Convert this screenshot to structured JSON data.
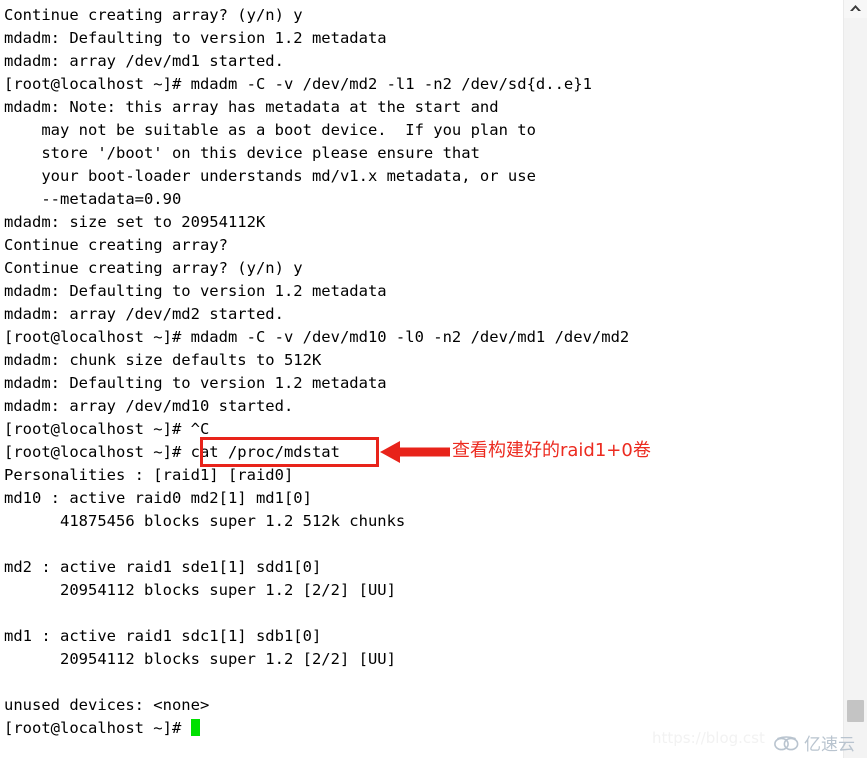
{
  "terminal": {
    "lines": [
      "Continue creating array? (y/n) y",
      "mdadm: Defaulting to version 1.2 metadata",
      "mdadm: array /dev/md1 started.",
      "[root@localhost ~]# mdadm -C -v /dev/md2 -l1 -n2 /dev/sd{d..e}1",
      "mdadm: Note: this array has metadata at the start and",
      "    may not be suitable as a boot device.  If you plan to",
      "    store '/boot' on this device please ensure that",
      "    your boot-loader understands md/v1.x metadata, or use",
      "    --metadata=0.90",
      "mdadm: size set to 20954112K",
      "Continue creating array?",
      "Continue creating array? (y/n) y",
      "mdadm: Defaulting to version 1.2 metadata",
      "mdadm: array /dev/md2 started.",
      "[root@localhost ~]# mdadm -C -v /dev/md10 -l0 -n2 /dev/md1 /dev/md2",
      "mdadm: chunk size defaults to 512K",
      "mdadm: Defaulting to version 1.2 metadata",
      "mdadm: array /dev/md10 started.",
      "[root@localhost ~]# ^C",
      "[root@localhost ~]# cat /proc/mdstat",
      "Personalities : [raid1] [raid0]",
      "md10 : active raid0 md2[1] md1[0]",
      "      41875456 blocks super 1.2 512k chunks",
      "",
      "md2 : active raid1 sde1[1] sdd1[0]",
      "      20954112 blocks super 1.2 [2/2] [UU]",
      "",
      "md1 : active raid1 sdc1[1] sdb1[0]",
      "      20954112 blocks super 1.2 [2/2] [UU]",
      "",
      "unused devices: <none>"
    ],
    "prompt_last": "[root@localhost ~]# ",
    "cursor_color": "#00e000",
    "text_color": "#000000",
    "background_color": "#ffffff"
  },
  "annotation": {
    "highlighted_command": "cat /proc/mdstat",
    "note_text": "查看构建好的raid1+0卷",
    "color": "#e8231a"
  },
  "scrollbar": {
    "up_arrow_icon": "chevron-up-icon",
    "track_color": "#f3f3f3",
    "thumb_color": "#c4c4c4"
  },
  "watermarks": {
    "url": "https://blog.cst",
    "brand": "亿速云",
    "brand_icon": "cloud-icon",
    "brand_color": "#b9c4cf"
  }
}
